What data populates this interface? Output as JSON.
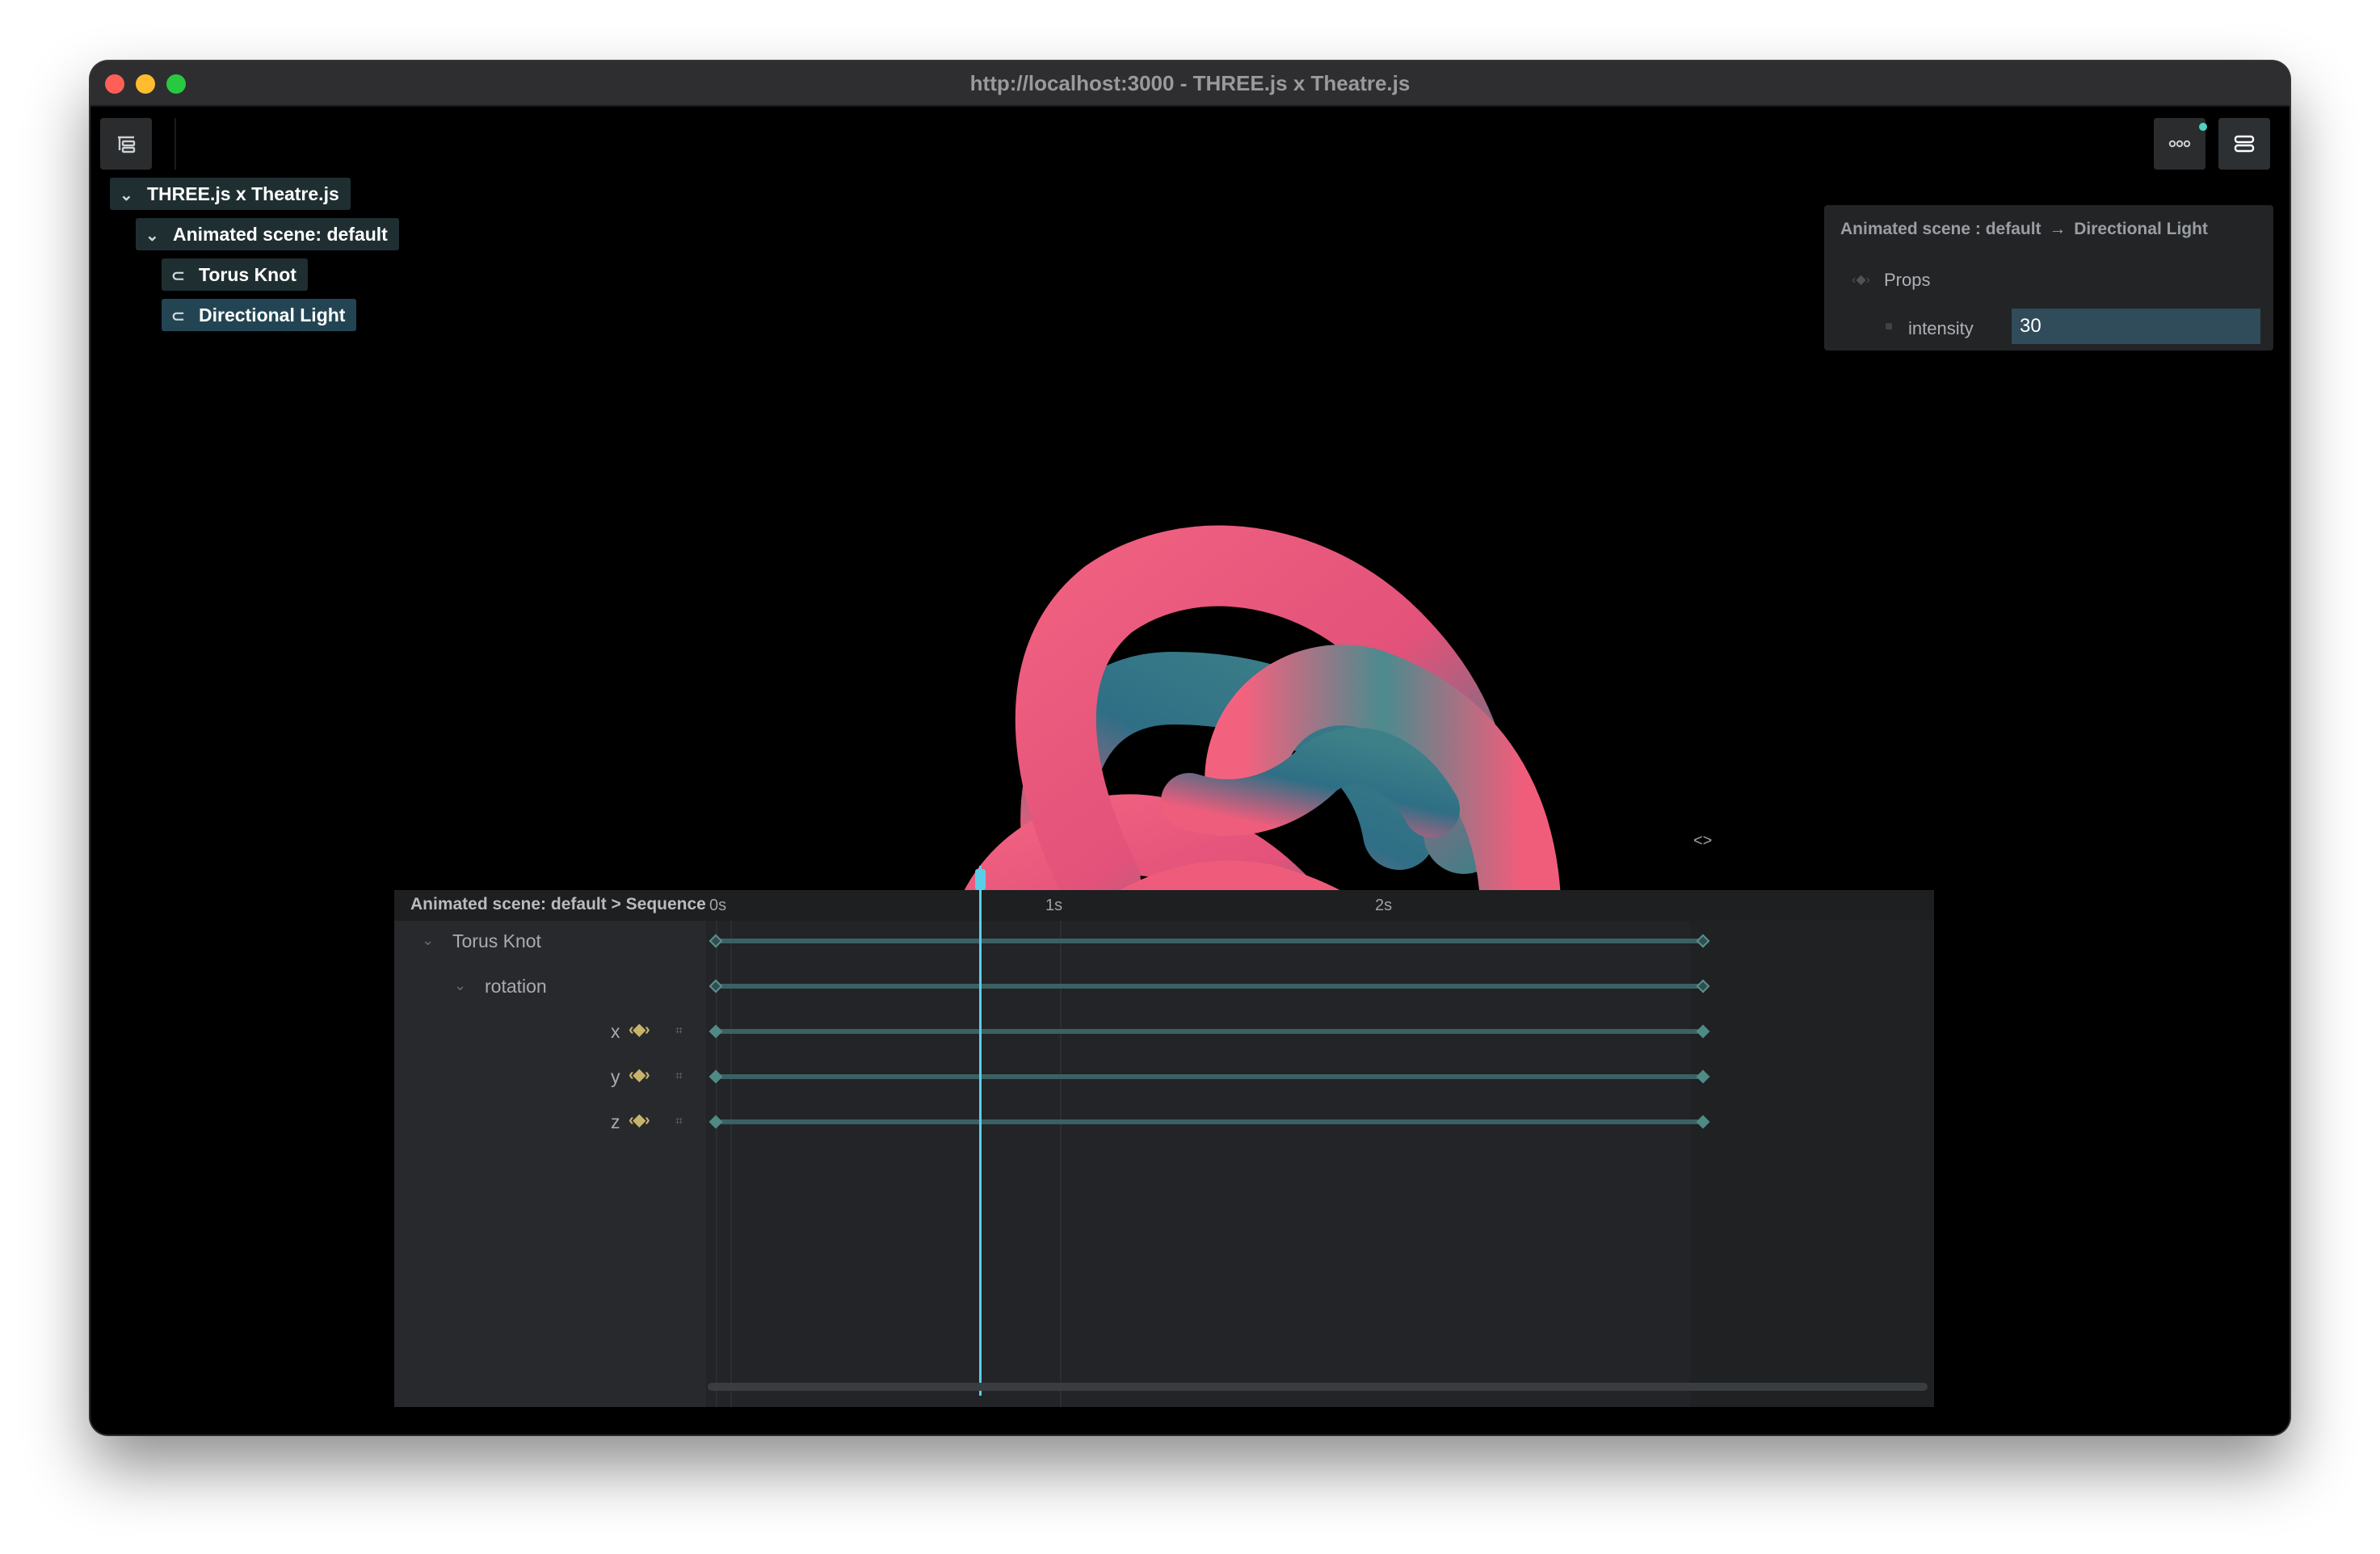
{
  "window": {
    "title": "http://localhost:3000 - THREE.js x Theatre.js"
  },
  "toolbar": {
    "outline_toggle_icon": "outline-list-icon",
    "more_icon": "more-horizontal-icon",
    "panel_toggle_icon": "properties-panel-icon"
  },
  "outline": {
    "items": [
      {
        "label": "THREE.js x Theatre.js",
        "icon": "chevron-down-icon"
      },
      {
        "label": "Animated scene: default",
        "icon": "chevron-down-icon"
      },
      {
        "label": "Torus Knot",
        "icon": "object-icon"
      },
      {
        "label": "Directional Light",
        "icon": "object-icon"
      }
    ]
  },
  "details_panel": {
    "breadcrumb_parent": "Animated scene : default",
    "breadcrumb_arrow": "→",
    "breadcrumb_child": "Directional Light",
    "props_label": "Props",
    "prop_name": "intensity",
    "prop_value": "30"
  },
  "timeline": {
    "header": "Animated scene: default > Sequence",
    "ticks": [
      "0s",
      "1s",
      "2s"
    ],
    "end_marker": "<>",
    "rows": {
      "object": "Torus Knot",
      "property": "rotation",
      "axes": [
        "x",
        "y",
        "z"
      ]
    },
    "playhead_time_s": 0.8,
    "sequence_length_s": 3
  },
  "colors": {
    "accent": "#5bcde8",
    "selected_item": "#234553",
    "keyframe": "#4f8a85",
    "knot_pink": "#f05d7b",
    "knot_teal": "#3f7f87"
  }
}
